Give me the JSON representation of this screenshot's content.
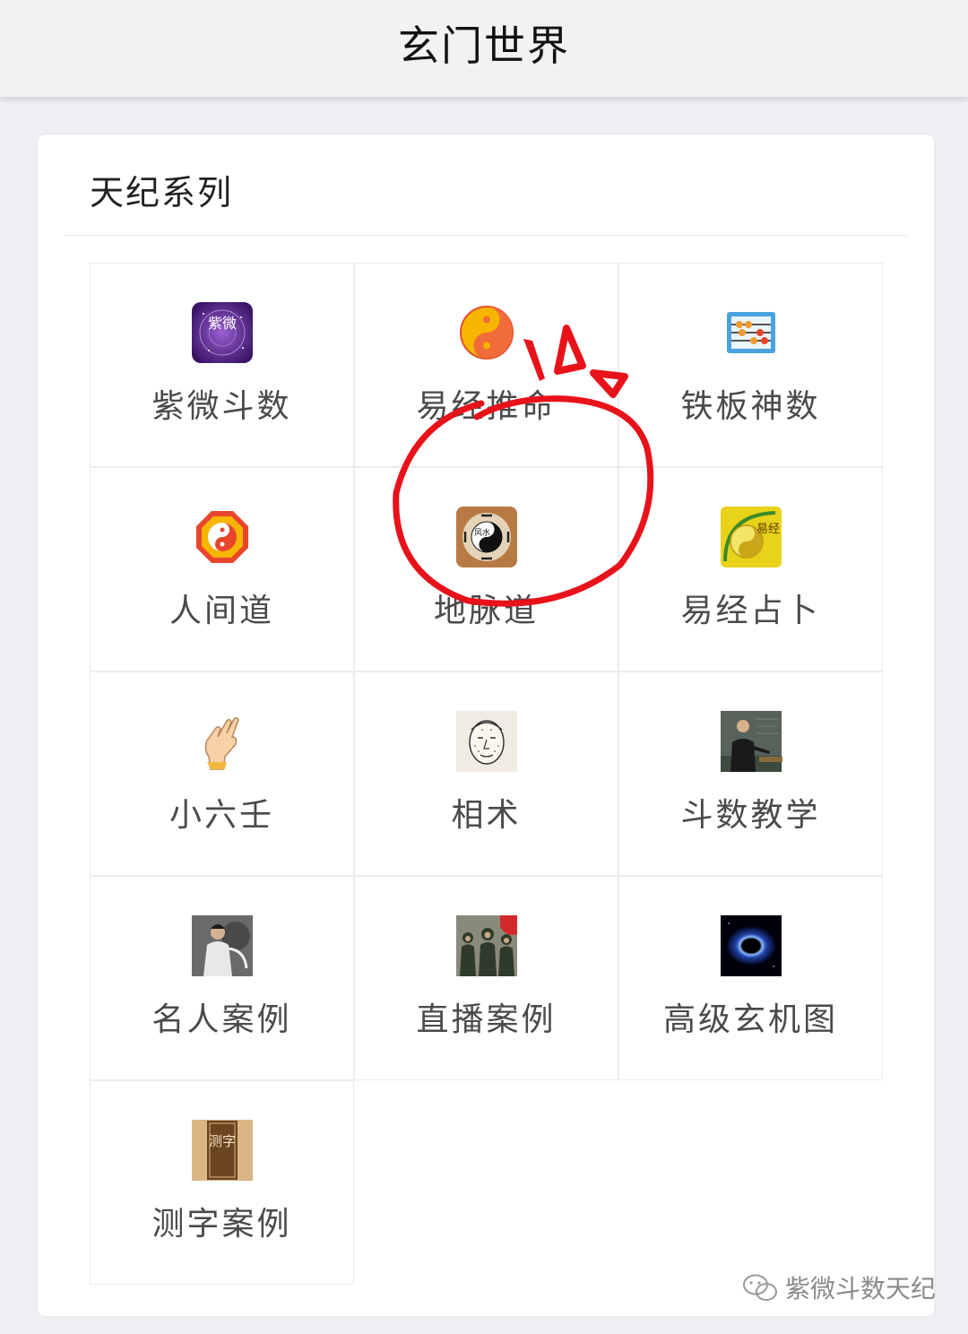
{
  "header": {
    "title": "玄门世界"
  },
  "section": {
    "title": "天纪系列"
  },
  "items": [
    {
      "label": "紫微斗数",
      "icon": "ziwei-app-icon"
    },
    {
      "label": "易经推命",
      "icon": "yin-yang-icon"
    },
    {
      "label": "铁板神数",
      "icon": "abacus-icon"
    },
    {
      "label": "人间道",
      "icon": "bagua-icon"
    },
    {
      "label": "地脉道",
      "icon": "fengshui-compass-icon"
    },
    {
      "label": "易经占卜",
      "icon": "yijing-divination-icon"
    },
    {
      "label": "小六壬",
      "icon": "hand-gesture-icon"
    },
    {
      "label": "相术",
      "icon": "face-reading-icon"
    },
    {
      "label": "斗数教学",
      "icon": "teacher-photo-icon"
    },
    {
      "label": "名人案例",
      "icon": "famous-person-icon"
    },
    {
      "label": "直播案例",
      "icon": "live-broadcast-icon"
    },
    {
      "label": "高级玄机图",
      "icon": "black-hole-icon"
    },
    {
      "label": "测字案例",
      "icon": "character-tablet-icon"
    }
  ],
  "icon_text": {
    "ziwei": "紫微",
    "fengshui": "风水",
    "yijing": "易经",
    "cezi": "测字"
  },
  "watermark": {
    "text": "紫微斗数天纪",
    "icon": "wechat-icon"
  },
  "colors": {
    "annotation_red": "#e8121a",
    "label_gray": "#4a4a4a"
  }
}
